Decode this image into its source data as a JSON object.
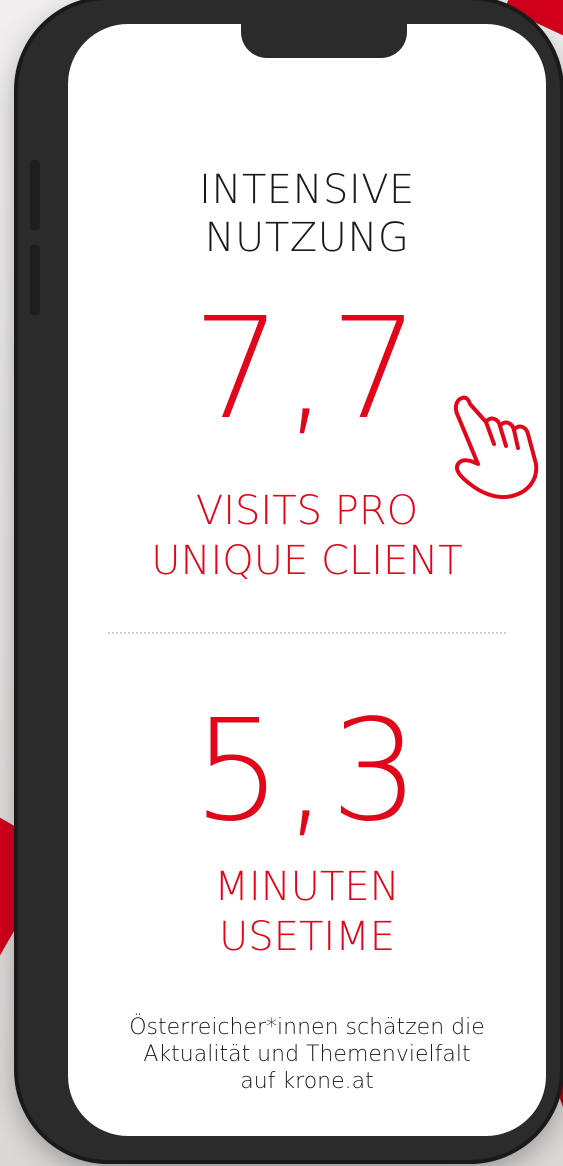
{
  "title_lines": [
    "INTENSIVE",
    "NUTZUNG"
  ],
  "stat1": {
    "value": "7,7",
    "label_lines": [
      "VISITS PRO",
      "UNIQUE CLIENT"
    ]
  },
  "stat2": {
    "value": "5,3",
    "label_lines": [
      "MINUTEN",
      "USETIME"
    ]
  },
  "footnote_lines": [
    "Österreicher*innen schätzen die",
    "Aktualität und Themenvielfalt",
    "auf krone.at"
  ],
  "icons": {
    "pointer": "pointing-hand-icon"
  },
  "colors": {
    "accent": "#e2061b",
    "text": "#1a1a1a",
    "phone_frame": "#2b2b2b"
  }
}
